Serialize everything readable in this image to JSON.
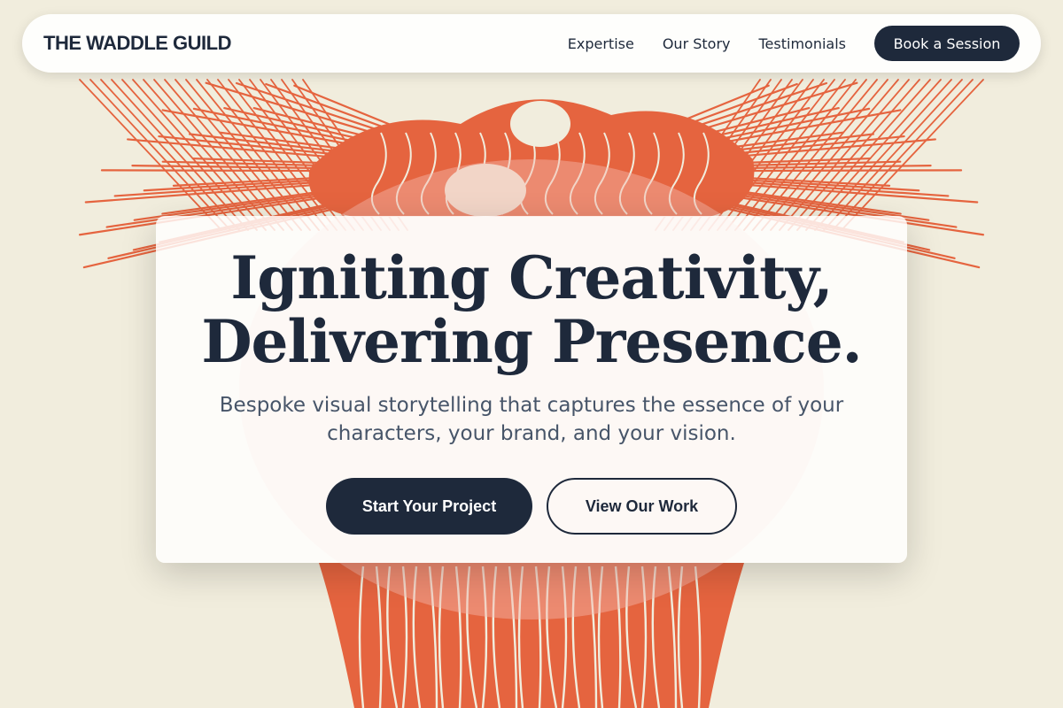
{
  "navbar": {
    "brand": "THE WADDLE GUILD",
    "links": [
      "Expertise",
      "Our Story",
      "Testimonials"
    ],
    "cta_label": "Book a Session"
  },
  "hero": {
    "title_line1": "Igniting Creativity,",
    "title_line2": "Delivering Presence.",
    "subtitle": "Bespoke visual storytelling that captures the essence of your characters, your brand, and your vision.",
    "primary_label": "Start Your Project",
    "secondary_label": "View Our Work"
  },
  "colors": {
    "background": "#f1eddd",
    "illustration": "#e5643f",
    "text_dark": "#1e293b",
    "text_muted": "#475569"
  },
  "background_art": "woodcut-illustration-two-figures-with-wings"
}
